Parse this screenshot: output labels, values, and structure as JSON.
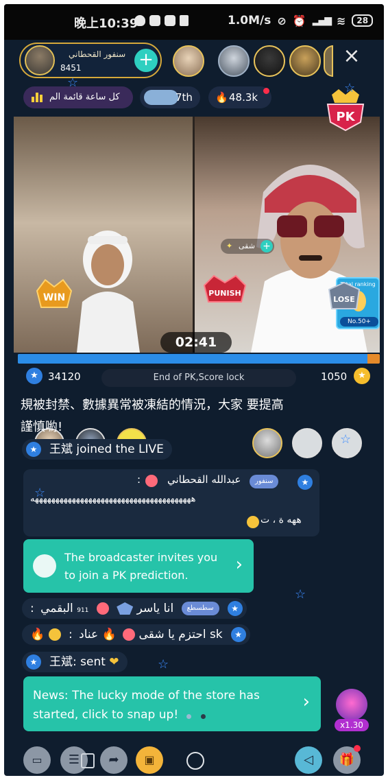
{
  "status_bar": {
    "time": "晚上10:39",
    "speed": "1.0M/s",
    "battery": "28"
  },
  "header": {
    "host_name": "سنفور القحطاني",
    "host_count": "451",
    "follow_symbol": "+",
    "close_symbol": "×"
  },
  "chips": {
    "rank_text": "كل ساعة قائمة الم",
    "place_text": "7th",
    "popularity": "48.3k"
  },
  "pk": {
    "badge_text": "PK",
    "right_streamer_name": "شقى",
    "win_label": "WIN",
    "punish_label": "PUNISH",
    "lose_label": "LOSE",
    "ranking_label": "Total ranking",
    "ranking_no": "No.50+",
    "timer": "02:41",
    "score_left": "34120",
    "score_right": "1050",
    "status": "End of PK,Score lock",
    "left_share": 0.965
  },
  "chat": {
    "system_line1": "規被封禁、數據異常被凍結的情況，大家 要提高",
    "system_line2": "謹慎喲!",
    "join_msg": "王斌 joined the LIVE",
    "msg1_badge": "سنفور",
    "msg1_name": "عبدالله القحطاني",
    "msg1_text": "هههههههههههههههههههههههههههههههههههههههه",
    "msg1_text2": "ههه ة ، ت",
    "pk_invite": "The broadcaster invites you to join a PK prediction.",
    "msg2_badge": "سطسطع",
    "msg2_name": "البقمي",
    "msg2_level": "911",
    "msg2_text": ": انا ياسر",
    "msg3_name": "عناد sk",
    "msg3_text": ": احتزم يا شقى",
    "gift_msg": "王斌: sent",
    "news": "News: The lucky mode of the store has started, click to snap up!",
    "lucky_mult": "x1.30"
  },
  "colors": {
    "teal": "#26c3a9",
    "blue_score": "#2b8de8",
    "orange_score": "#e58a2a",
    "background": "#0f1d2e"
  },
  "icons": [
    "chat-icon",
    "list-icon",
    "share-icon",
    "camera-switch-icon",
    "home-circle-icon",
    "back-triangle-icon",
    "gift-icon"
  ]
}
